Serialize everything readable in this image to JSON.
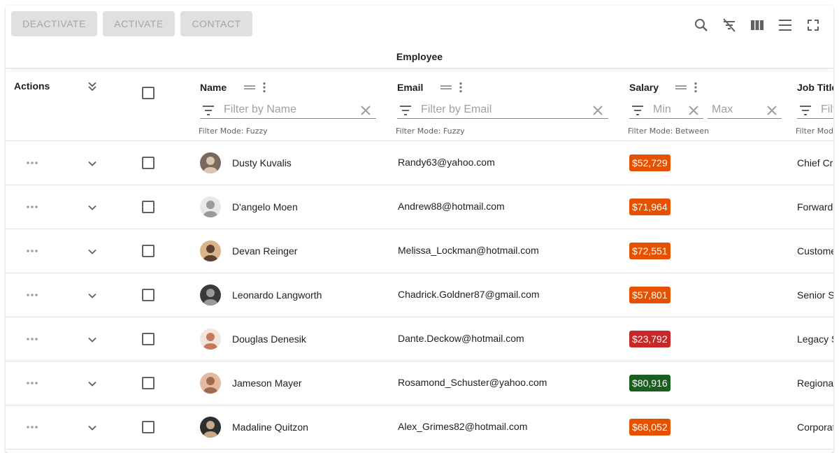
{
  "toolbar": {
    "buttons": [
      "Deactivate",
      "Activate",
      "Contact"
    ],
    "icons": [
      "search-icon",
      "filter-off-icon",
      "columns-icon",
      "density-icon",
      "fullscreen-icon"
    ]
  },
  "group_header": "Employee",
  "columns": {
    "actions": "Actions",
    "name": {
      "title": "Name",
      "placeholder": "Filter by Name",
      "mode": "Filter Mode: Fuzzy"
    },
    "email": {
      "title": "Email",
      "placeholder": "Filter by Email",
      "mode": "Filter Mode: Fuzzy"
    },
    "salary": {
      "title": "Salary",
      "min": "Min",
      "max": "Max",
      "mode": "Filter Mode: Between"
    },
    "job": {
      "title": "Job Title",
      "placeholder": "Filter by Job Title",
      "mode": "Filter Mode: Fuzzy"
    }
  },
  "rows": [
    {
      "name": "Dusty Kuvalis",
      "email": "Randy63@yahoo.com",
      "salary": "$52,729",
      "salary_color": "#e65100",
      "job": "Chief Creative Technician",
      "avatar_bg": "#7a6a5c",
      "avatar_fg": "#d8c6b0"
    },
    {
      "name": "D'angelo Moen",
      "email": "Andrew88@hotmail.com",
      "salary": "$71,964",
      "salary_color": "#e65100",
      "job": "Forward Response Engineer",
      "avatar_bg": "#e8e8e8",
      "avatar_fg": "#9a9a9a"
    },
    {
      "name": "Devan Reinger",
      "email": "Melissa_Lockman@hotmail.com",
      "salary": "$72,551",
      "salary_color": "#e65100",
      "job": "Customer Intranet Consultant",
      "avatar_bg": "#d9b48a",
      "avatar_fg": "#5a4030"
    },
    {
      "name": "Leonardo Langworth",
      "email": "Chadrick.Goldner87@gmail.com",
      "salary": "$57,801",
      "salary_color": "#e65100",
      "job": "Senior Security Manager",
      "avatar_bg": "#3a3a3a",
      "avatar_fg": "#9a9a9a"
    },
    {
      "name": "Douglas Denesik",
      "email": "Dante.Deckow@hotmail.com",
      "salary": "$23,792",
      "salary_color": "#c62828",
      "job": "Legacy Software Assistant",
      "avatar_bg": "#f2e6dc",
      "avatar_fg": "#c47a5a"
    },
    {
      "name": "Jameson Mayer",
      "email": "Rosamond_Schuster@yahoo.com",
      "salary": "$80,916",
      "salary_color": "#1b5e20",
      "job": "Regional Division Planner",
      "avatar_bg": "#e3b9a0",
      "avatar_fg": "#a06a50"
    },
    {
      "name": "Madaline Quitzon",
      "email": "Alex_Grimes82@hotmail.com",
      "salary": "$68,052",
      "salary_color": "#e65100",
      "job": "Corporate Paradigm Strategist",
      "avatar_bg": "#2e2e2e",
      "avatar_fg": "#c9a88a"
    }
  ]
}
